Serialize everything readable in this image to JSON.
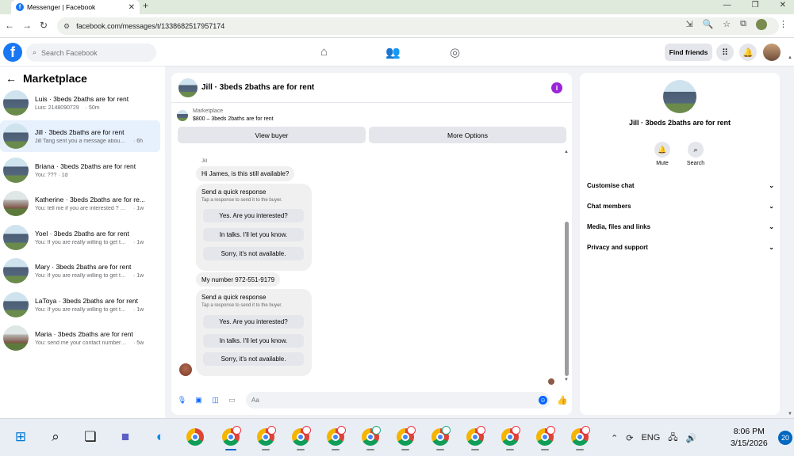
{
  "browser": {
    "tab_title": "Messenger | Facebook",
    "new_tab_glyph": "+",
    "url": "facebook.com/messages/t/1338682517957174"
  },
  "fb_header": {
    "search_placeholder": "Search Facebook",
    "find_friends": "Find friends",
    "nav_icons": [
      "home-icon",
      "friends-icon",
      "groups-icon"
    ],
    "right_icons": [
      "menu-grid-icon",
      "notifications-icon"
    ]
  },
  "left": {
    "title": "Marketplace",
    "conversations": [
      {
        "name": "Luis · 3beds 2baths are for rent",
        "preview": "Luis: 2148090729",
        "time": "· 50m"
      },
      {
        "name": "Jill · 3beds 2baths are for rent",
        "preview": "Jill Tang sent you a message about yo...",
        "time": "· 6h",
        "active": true
      },
      {
        "name": "Briana · 3beds 2baths are for rent",
        "preview": "You: ??? · 1d",
        "time": ""
      },
      {
        "name": "Katherine · 3beds 2baths are for re...",
        "preview": "You: tell me if you are interested ? this ...",
        "time": "· 1w"
      },
      {
        "name": "Yoel · 3beds 2baths are for rent",
        "preview": "You: If you are really willing to get thi...",
        "time": "· 1w"
      },
      {
        "name": "Mary · 3beds 2baths are for rent",
        "preview": "You: If you are really willing to get thi...",
        "time": "· 1w"
      },
      {
        "name": "LaToya · 3beds 2baths are for rent",
        "preview": "You: If you are really willing to get thi...",
        "time": "· 1w"
      },
      {
        "name": "Maria · 3beds 2baths are for rent",
        "preview": "You: send me your contact number i ...",
        "time": "· 5w"
      }
    ]
  },
  "chat": {
    "title": "Jill · 3beds 2baths are for rent",
    "marketplace_label": "Marketplace",
    "listing": "$800 – 3beds 2baths are for rent",
    "view_buyer": "View buyer",
    "more_options": "More Options",
    "sender_name": "Jill",
    "message1": "Hi James, is this still available?",
    "quick1": {
      "title": "Send a quick response",
      "subtitle": "Tap a response to send it to the buyer.",
      "options": [
        "Yes. Are you interested?",
        "In talks. I'll let you know.",
        "Sorry, it's not available."
      ]
    },
    "message2": "My number 972-551-9179",
    "quick2": {
      "title": "Send a quick response",
      "subtitle": "Tap a response to send it to the buyer.",
      "options": [
        "Yes. Are you interested?",
        "In talks. I'll let you know.",
        "Sorry, it's not available."
      ]
    },
    "input_placeholder": "Aa"
  },
  "right": {
    "name": "Jill · 3beds 2baths are for rent",
    "mute": "Mute",
    "search": "Search",
    "sections": [
      "Customise chat",
      "Chat members",
      "Media, files and links",
      "Privacy and support"
    ]
  },
  "taskbar": {
    "language": "ENG",
    "time": "8:06 PM",
    "date": "3/15/2026",
    "notifications": "20"
  },
  "colors": {
    "fb_blue": "#1877f2",
    "messenger_blue": "#0866ff",
    "active_conv_bg": "#e7f0fd",
    "info_purple": "#9b24d9"
  }
}
